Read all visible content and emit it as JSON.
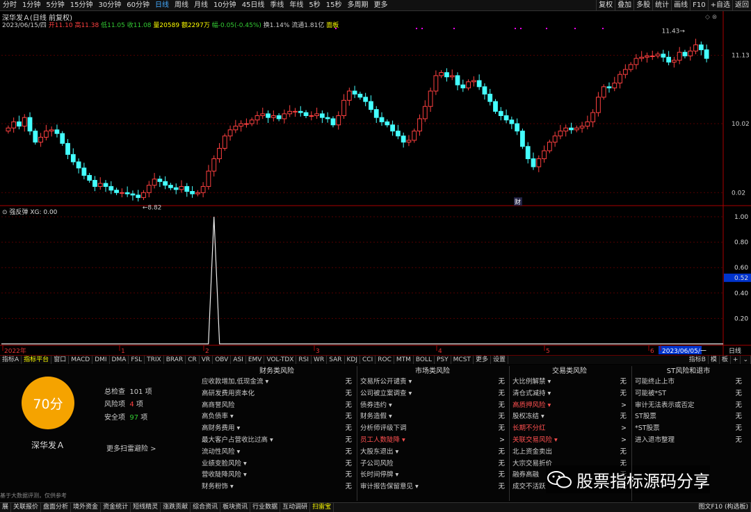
{
  "toolbar": {
    "periods": [
      "分时",
      "1分钟",
      "5分钟",
      "15分钟",
      "30分钟",
      "60分钟",
      "日线",
      "周线",
      "月线",
      "10分钟",
      "45日线",
      "季线",
      "年线",
      "5秒",
      "15秒",
      "多周期",
      "更多"
    ],
    "active_period": "日线",
    "right": [
      "复权",
      "叠加",
      "多股",
      "统计",
      "画线",
      "F10",
      "+自选",
      "返回"
    ]
  },
  "stock": {
    "title": "深华发Ａ(日线 前复权)",
    "date": "2023/06/15/四",
    "open_label": "开",
    "open": "11.10",
    "high_label": "高",
    "high": "11.38",
    "low_label": "低",
    "low": "11.05",
    "close_label": "收",
    "close": "11.08",
    "vol_label": "量",
    "vol": "20589",
    "amount_label": "额",
    "amount": "2297万",
    "change_label": "幅",
    "change": "-0.05(-0.45%)",
    "turnover_label": "换",
    "turnover": "1.14%",
    "float_label": "流通",
    "float": "1.81亿",
    "board": "面板"
  },
  "chart_data": {
    "type": "candlestick",
    "price_axis": [
      "11.13",
      "10.02",
      "0.02"
    ],
    "price_marks": {
      "high": "11.43",
      "low": "8.82"
    },
    "event_marker": "财",
    "time_axis": [
      "2022年",
      "1",
      "2",
      "3",
      "4",
      "5",
      "6",
      "2023/06/05/一"
    ],
    "period_label": "日线",
    "candles_close": [
      9.95,
      10.05,
      9.98,
      10.12,
      9.9,
      9.72,
      9.8,
      9.9,
      9.92,
      9.86,
      9.7,
      9.52,
      9.4,
      9.3,
      9.18,
      9.1,
      9.0,
      9.05,
      9.0,
      8.94,
      8.9,
      8.9,
      8.88,
      8.86,
      8.82,
      8.9,
      9.02,
      9.12,
      9.08,
      9.02,
      8.98,
      8.95,
      9.0,
      8.92,
      8.88,
      8.9,
      9.0,
      9.25,
      9.45,
      9.62,
      9.82,
      9.92,
      9.98,
      10.02,
      10.02,
      10.08,
      10.15,
      10.18,
      10.12,
      10.15,
      10.1,
      10.18,
      10.22,
      10.22,
      10.2,
      10.15,
      10.15,
      10.18,
      10.12,
      10.1,
      10.0,
      10.15,
      10.4,
      10.55,
      10.5,
      10.45,
      10.38,
      10.25,
      10.12,
      10.05,
      10.0,
      9.9,
      9.82,
      9.72,
      9.75,
      9.9,
      10.1,
      10.3,
      10.55,
      10.8,
      10.85,
      10.78,
      10.8,
      10.65,
      10.6,
      10.7,
      10.72,
      10.62,
      10.5,
      10.38,
      10.22,
      10.15,
      10.08,
      10.02,
      9.9,
      9.65,
      9.45,
      9.32,
      9.45,
      9.58,
      9.72,
      9.82,
      9.9,
      9.95,
      9.92,
      9.95,
      9.98,
      10.05,
      10.2,
      10.45,
      10.62,
      10.6,
      10.68,
      10.82,
      10.9,
      10.98,
      11.08,
      11.1,
      11.12,
      11.12,
      11.15,
      11.1,
      11.02,
      11.05,
      11.18,
      11.12,
      11.2,
      11.3,
      11.22,
      11.08
    ],
    "indicator": {
      "name": "强反弹",
      "series": "XG",
      "value": "0.00",
      "axis": [
        "1.00",
        "0.80",
        "0.60",
        "0.52",
        "0.40",
        "0.20"
      ],
      "spike_index": 38,
      "spike_value": 1.0
    }
  },
  "indicator_tabs": [
    "指标A",
    "指标平台",
    "窗口",
    "MACD",
    "DMI",
    "DMA",
    "FSL",
    "TRIX",
    "BRAR",
    "CR",
    "VR",
    "OBV",
    "ASI",
    "EMV",
    "VOL-TDX",
    "RSI",
    "WR",
    "SAR",
    "KDJ",
    "CCI",
    "ROC",
    "MTM",
    "BOLL",
    "PSY",
    "MCST",
    "更多",
    "设置"
  ],
  "indicator_tabs_right": [
    "指标B",
    "模",
    "板"
  ],
  "scan": {
    "score": "70分",
    "name": "深华发Ａ",
    "total_label": "总检查",
    "total": "101",
    "total_unit": "项",
    "risk_label": "风险项",
    "risk": "4",
    "risk_unit": "项",
    "safe_label": "安全项",
    "safe": "97",
    "safe_unit": "项",
    "more": "更多扫雷避险 >",
    "footnote": "基于大数据评测，仅供参考",
    "columns": [
      {
        "title": "财务类风险",
        "rows": [
          {
            "label": "应收款增加,低现金流 ▾",
            "status": "无"
          },
          {
            "label": "高研发费用资本化",
            "status": "无"
          },
          {
            "label": "高商誉风险",
            "status": "无"
          },
          {
            "label": "高负债率 ▾",
            "status": "无"
          },
          {
            "label": "高财务费用 ▾",
            "status": "无"
          },
          {
            "label": "最大客户占营收比过高 ▾",
            "status": "无"
          },
          {
            "label": "流动性风险 ▾",
            "status": "无"
          },
          {
            "label": "业绩变脸风险 ▾",
            "status": "无"
          },
          {
            "label": "营收陡降风险 ▾",
            "status": "无"
          },
          {
            "label": "财务粉饰 ▾",
            "status": "无"
          }
        ]
      },
      {
        "title": "市场类风险",
        "rows": [
          {
            "label": "交易所公开谴责 ▾",
            "status": "无"
          },
          {
            "label": "公司被立案调查 ▾",
            "status": "无"
          },
          {
            "label": "债券违约 ▾",
            "status": "无"
          },
          {
            "label": "财务造假 ▾",
            "status": "无"
          },
          {
            "label": "分析师评级下调",
            "status": "无"
          },
          {
            "label": "员工人数陡降 ▾",
            "status": ">",
            "warn": true
          },
          {
            "label": "大股东退出 ▾",
            "status": "无"
          },
          {
            "label": "子公司风险",
            "status": "无"
          },
          {
            "label": "长时间停牌 ▾",
            "status": "无"
          },
          {
            "label": "审计报告保留意见 ▾",
            "status": "无"
          }
        ]
      },
      {
        "title": "交易类风险",
        "rows": [
          {
            "label": "大比例解禁 ▾",
            "status": "无"
          },
          {
            "label": "清仓式减持 ▾",
            "status": "无"
          },
          {
            "label": "高质押风险 ▾",
            "status": ">",
            "warn": true
          },
          {
            "label": "股权冻结 ▾",
            "status": "无"
          },
          {
            "label": "长期不分红",
            "status": ">",
            "warn": true
          },
          {
            "label": "关联交易风险 ▾",
            "status": ">",
            "warn": true
          },
          {
            "label": "北上资金卖出",
            "status": "无"
          },
          {
            "label": "大宗交易折价",
            "status": "无"
          },
          {
            "label": "融券高融",
            "status": "无"
          },
          {
            "label": "成交不活跃",
            "status": "无"
          }
        ]
      },
      {
        "title": "ST风险和退市",
        "rows": [
          {
            "label": "可能终止上市",
            "status": "无"
          },
          {
            "label": "可能被*ST",
            "status": "无"
          },
          {
            "label": "审计无法表示或否定",
            "status": "无"
          },
          {
            "label": "ST股票",
            "status": "无"
          },
          {
            "label": "*ST股票",
            "status": "无"
          },
          {
            "label": "进入退市整理",
            "status": "无"
          }
        ]
      }
    ]
  },
  "bottom": [
    "展",
    "关联报价",
    "盘面分析",
    "境外资金",
    "资金统计",
    "短线精灵",
    "涨跌贡献",
    "综合资讯",
    "板块资讯",
    "行业数据",
    "互动调研",
    "扫雷宝"
  ],
  "bottom_active": "扫雷宝",
  "bottom_right": "图文F10 (构选板)",
  "watermark": "股票指标源码分享",
  "colors": {
    "up": "#ff4040",
    "down": "#4ff",
    "panel_accent": "#f5a300"
  }
}
